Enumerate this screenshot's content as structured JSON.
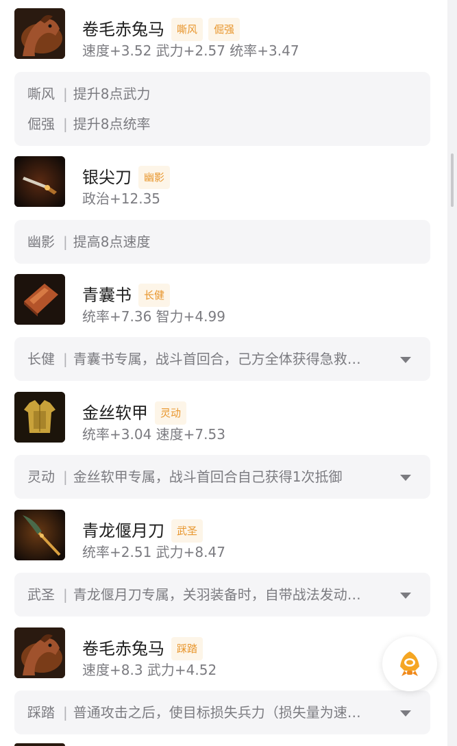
{
  "accent": "#e8962d",
  "items": [
    {
      "name": "卷毛赤兔马",
      "icon": "horse-icon",
      "tags": [
        "嘶风",
        "倔强"
      ],
      "stats": "速度+3.52 武力+2.57 统率+3.47",
      "effects": [
        {
          "tag": "嘶风",
          "text": "提升8点武力"
        },
        {
          "tag": "倔强",
          "text": "提升8点统率"
        }
      ]
    },
    {
      "name": "银尖刀",
      "icon": "dagger-icon",
      "tags": [
        "幽影"
      ],
      "stats": "政治+12.35",
      "effects": [
        {
          "tag": "幽影",
          "text": "提高8点速度"
        }
      ]
    },
    {
      "name": "青囊书",
      "icon": "book-icon",
      "tags": [
        "长健"
      ],
      "stats": "统率+7.36 智力+4.99",
      "effects": [
        {
          "tag": "长健",
          "text": "青囊书专属，战斗首回合，己方全体获得急救…"
        }
      ]
    },
    {
      "name": "金丝软甲",
      "icon": "armor-icon",
      "tags": [
        "灵动"
      ],
      "stats": "统率+3.04 速度+7.53",
      "effects": [
        {
          "tag": "灵动",
          "text": "金丝软甲专属，战斗首回合自己获得1次抵御"
        }
      ]
    },
    {
      "name": "青龙偃月刀",
      "icon": "glaive-icon",
      "tags": [
        "武圣"
      ],
      "stats": "统率+2.51 武力+8.47",
      "effects": [
        {
          "tag": "武圣",
          "text": "青龙偃月刀专属，关羽装备时，自带战法发动…"
        }
      ]
    },
    {
      "name": "卷毛赤兔马",
      "icon": "horse-icon",
      "tags": [
        "踩踏"
      ],
      "stats": "速度+8.3 武力+4.52",
      "effects": [
        {
          "tag": "踩踏",
          "text": "普通攻击之后，使目标损失兵力（损失量为速…"
        }
      ]
    }
  ],
  "fab_icon": "rocket-icon"
}
